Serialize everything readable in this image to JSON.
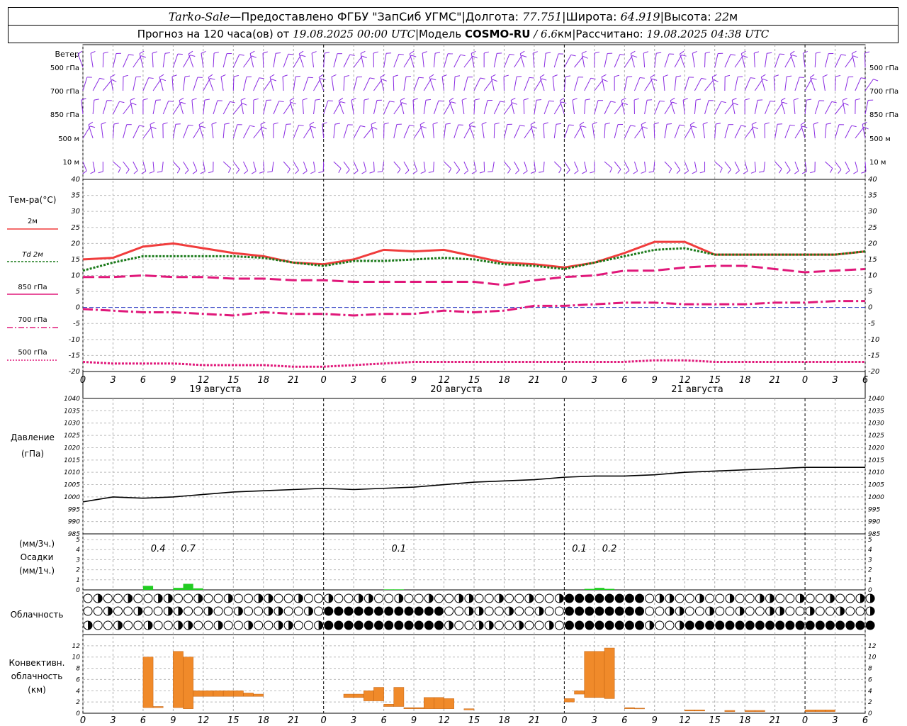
{
  "header": {
    "station": "Tarko-Sale",
    "dash": " — ",
    "provider": "Предоставлено ФГБУ \"ЗапСиб УГМС\"",
    "lon_label": "Долгота:",
    "lon": "77.751",
    "lat_label": "Широта:",
    "lat": "64.919",
    "alt_label": "Высота:",
    "alt": "22",
    "alt_unit": "м",
    "sep": " | ",
    "forecast_prefix": "Прогноз на 120 часа(ов) от",
    "forecast_time": "19.08.2025 00:00 UTC",
    "model_label": "Модель",
    "model": "COSMO-RU",
    "model_res": "/ 6.6",
    "model_res_unit": "км",
    "calc_label": "Рассчитано:",
    "calc_time": "19.08.2025 04:38 UTC"
  },
  "wind": {
    "title": "Ветер",
    "levels": [
      "500 гПа",
      "700 гПа",
      "850 гПа",
      "500 м",
      "10 м"
    ],
    "colors": {
      "barb": "#8a2be2"
    }
  },
  "temp_legend": {
    "title": "Тем-ра(°С)",
    "items": [
      {
        "label": "2м",
        "color": "#f03c3c"
      },
      {
        "label": "Td 2м",
        "color": "#1a7a1a"
      },
      {
        "label": "850 гПа",
        "color": "#e0187a"
      },
      {
        "label": "700 гПа",
        "color": "#e0187a"
      },
      {
        "label": "500 гПа",
        "color": "#e0187a"
      }
    ]
  },
  "pressure_labels": {
    "title": "Давление",
    "unit": "(гПа)"
  },
  "precip_labels": {
    "unit_3h": "(мм/3ч.)",
    "title": "Осадки",
    "unit_1h": "(мм/1ч.)"
  },
  "cloud_labels": {
    "title": "Облачность"
  },
  "conv_labels": {
    "line1": "Конвективн.",
    "line2": "облачность",
    "line3": "(км)"
  },
  "days": [
    "19 августа",
    "20 августа",
    "21 августа"
  ],
  "hour_ticks": [
    "0",
    "3",
    "6",
    "9",
    "12",
    "15",
    "18",
    "21",
    "0",
    "3",
    "6",
    "9",
    "12",
    "15",
    "18",
    "21",
    "0",
    "3",
    "6",
    "9",
    "12",
    "15",
    "18",
    "21",
    "0",
    "3",
    "6"
  ],
  "chart_data": [
    {
      "type": "line",
      "panel": "temperature",
      "ylim": [
        -20,
        40
      ],
      "yticks": [
        -20,
        -15,
        -10,
        -5,
        0,
        5,
        10,
        15,
        20,
        25,
        30,
        35,
        40
      ],
      "x_hours": [
        0,
        3,
        6,
        9,
        12,
        15,
        18,
        21,
        24,
        27,
        30,
        33,
        36,
        39,
        42,
        45,
        48,
        51,
        54,
        57,
        60,
        63,
        66,
        69,
        72,
        75,
        78
      ],
      "series": [
        {
          "name": "2м",
          "color": "#f03c3c",
          "style": "solid",
          "values": [
            15,
            15.5,
            19,
            20,
            18.5,
            17,
            16,
            14,
            13.5,
            15,
            18,
            17.5,
            18,
            16,
            14,
            13.5,
            12.5,
            14,
            17,
            20.5,
            20.5,
            16.5,
            16.5,
            16.5,
            16.5,
            16.5,
            17.5
          ]
        },
        {
          "name": "Td 2м",
          "color": "#1a7a1a",
          "style": "dot",
          "values": [
            11.5,
            14,
            16,
            16,
            16,
            16,
            15.5,
            14,
            13,
            14.5,
            14.5,
            15,
            15.5,
            15,
            13.5,
            13,
            12,
            14,
            16,
            18,
            18.5,
            16.5,
            16.5,
            16.5,
            16.5,
            16.5,
            17.5
          ]
        },
        {
          "name": "850 гПа",
          "color": "#e0187a",
          "style": "dash",
          "values": [
            9.5,
            9.5,
            10,
            9.5,
            9.5,
            9,
            9,
            8.5,
            8.5,
            8,
            8,
            8,
            8,
            8,
            7,
            8.5,
            9.5,
            10,
            11.5,
            11.5,
            12.5,
            13,
            13,
            12,
            11,
            11.5,
            12
          ]
        },
        {
          "name": "700 гПа",
          "color": "#e0187a",
          "style": "dashdot",
          "values": [
            -0.5,
            -1,
            -1.5,
            -1.5,
            -2,
            -2.5,
            -1.5,
            -2,
            -2,
            -2.5,
            -2,
            -2,
            -1,
            -1.5,
            -1,
            0.5,
            0.5,
            1,
            1.5,
            1.5,
            1,
            1,
            1,
            1.5,
            1.5,
            2,
            2
          ]
        },
        {
          "name": "500 гПа",
          "color": "#e0187a",
          "style": "dot",
          "values": [
            -17,
            -17.5,
            -17.5,
            -17.5,
            -18,
            -18,
            -18,
            -18.5,
            -18.5,
            -18,
            -17.5,
            -17,
            -17,
            -17,
            -17,
            -17,
            -17,
            -17,
            -17,
            -16.5,
            -16.5,
            -17,
            -17,
            -17,
            -17,
            -17,
            -17
          ]
        }
      ]
    },
    {
      "type": "line",
      "panel": "pressure",
      "ylabel": "Давление (гПа)",
      "ylim": [
        985,
        1040
      ],
      "yticks": [
        985,
        990,
        995,
        1000,
        1005,
        1010,
        1015,
        1020,
        1025,
        1030,
        1035,
        1040
      ],
      "x_hours": [
        0,
        3,
        6,
        9,
        12,
        15,
        18,
        21,
        24,
        27,
        30,
        33,
        36,
        39,
        42,
        45,
        48,
        51,
        54,
        57,
        60,
        63,
        66,
        69,
        72,
        75,
        78
      ],
      "series": [
        {
          "name": "",
          "color": "#000000",
          "values": [
            998,
            1000,
            999.5,
            1000,
            1001,
            1002,
            1002.5,
            1003,
            1003.5,
            1003,
            1003.5,
            1004,
            1005,
            1006,
            1006.5,
            1007,
            1008,
            1008.5,
            1008.5,
            1009,
            1010,
            1010.5,
            1011,
            1011.5,
            1012,
            1012,
            1012
          ]
        }
      ]
    },
    {
      "type": "bar",
      "panel": "precipitation",
      "ylim": [
        0,
        5
      ],
      "yticks": [
        0,
        1,
        2,
        3,
        4,
        5
      ],
      "annotations": [
        {
          "hour": 7.5,
          "text": "0.4"
        },
        {
          "hour": 10.5,
          "text": "0.7"
        },
        {
          "hour": 31.5,
          "text": "0.1"
        },
        {
          "hour": 49.5,
          "text": "0.1"
        },
        {
          "hour": 52.5,
          "text": "0.2"
        }
      ],
      "bars": [
        {
          "hour": 6,
          "value": 0.4
        },
        {
          "hour": 9,
          "value": 0.2
        },
        {
          "hour": 10,
          "value": 0.6
        },
        {
          "hour": 11,
          "value": 0.15
        },
        {
          "hour": 30,
          "value": 0.05
        },
        {
          "hour": 31,
          "value": 0.05
        },
        {
          "hour": 50,
          "value": 0.1
        },
        {
          "hour": 51,
          "value": 0.2
        },
        {
          "hour": 52,
          "value": 0.1
        }
      ],
      "color": "#22cc22"
    },
    {
      "type": "bar",
      "panel": "convective_cloud",
      "ylabel": "Конвективн. облачность (км)",
      "ylim": [
        0,
        14
      ],
      "yticks": [
        0,
        2,
        4,
        6,
        8,
        10,
        12
      ],
      "color": "#f08a2a",
      "bars": [
        {
          "hour": 6,
          "bottom": 1,
          "top": 10
        },
        {
          "hour": 7,
          "bottom": 1,
          "top": 1.2
        },
        {
          "hour": 9,
          "bottom": 1,
          "top": 11
        },
        {
          "hour": 10,
          "bottom": 0.8,
          "top": 10
        },
        {
          "hour": 11,
          "bottom": 3,
          "top": 4
        },
        {
          "hour": 12,
          "bottom": 3,
          "top": 4
        },
        {
          "hour": 13,
          "bottom": 3,
          "top": 4
        },
        {
          "hour": 14,
          "bottom": 3,
          "top": 4
        },
        {
          "hour": 15,
          "bottom": 3,
          "top": 4
        },
        {
          "hour": 16,
          "bottom": 3,
          "top": 3.6
        },
        {
          "hour": 17,
          "bottom": 3,
          "top": 3.4
        },
        {
          "hour": 26,
          "bottom": 2.8,
          "top": 3.4
        },
        {
          "hour": 27,
          "bottom": 2.8,
          "top": 3.4
        },
        {
          "hour": 28,
          "bottom": 2.2,
          "top": 4
        },
        {
          "hour": 29,
          "bottom": 2.2,
          "top": 4.6
        },
        {
          "hour": 30,
          "bottom": 1.2,
          "top": 1.6
        },
        {
          "hour": 31,
          "bottom": 1.2,
          "top": 4.6
        },
        {
          "hour": 32,
          "bottom": 0.8,
          "top": 1
        },
        {
          "hour": 33,
          "bottom": 0.8,
          "top": 1
        },
        {
          "hour": 34,
          "bottom": 0.8,
          "top": 2.8
        },
        {
          "hour": 35,
          "bottom": 0.8,
          "top": 2.8
        },
        {
          "hour": 36,
          "bottom": 0.8,
          "top": 2.6
        },
        {
          "hour": 38,
          "bottom": 0.6,
          "top": 0.8
        },
        {
          "hour": 48,
          "bottom": 2,
          "top": 2.6
        },
        {
          "hour": 49,
          "bottom": 3.4,
          "top": 4
        },
        {
          "hour": 50,
          "bottom": 2.8,
          "top": 11
        },
        {
          "hour": 51,
          "bottom": 2.8,
          "top": 11
        },
        {
          "hour": 52,
          "bottom": 2.6,
          "top": 11.6
        },
        {
          "hour": 54,
          "bottom": 0.8,
          "top": 1
        },
        {
          "hour": 55,
          "bottom": 0.8,
          "top": 0.9
        },
        {
          "hour": 60,
          "bottom": 0.4,
          "top": 0.6
        },
        {
          "hour": 61,
          "bottom": 0.4,
          "top": 0.6
        },
        {
          "hour": 64,
          "bottom": 0.3,
          "top": 0.5
        },
        {
          "hour": 66,
          "bottom": 0.3,
          "top": 0.5
        },
        {
          "hour": 67,
          "bottom": 0.3,
          "top": 0.5
        },
        {
          "hour": 72,
          "bottom": 0.3,
          "top": 0.6
        },
        {
          "hour": 73,
          "bottom": 0.3,
          "top": 0.6
        },
        {
          "hour": 74,
          "bottom": 0.3,
          "top": 0.6
        }
      ]
    }
  ]
}
